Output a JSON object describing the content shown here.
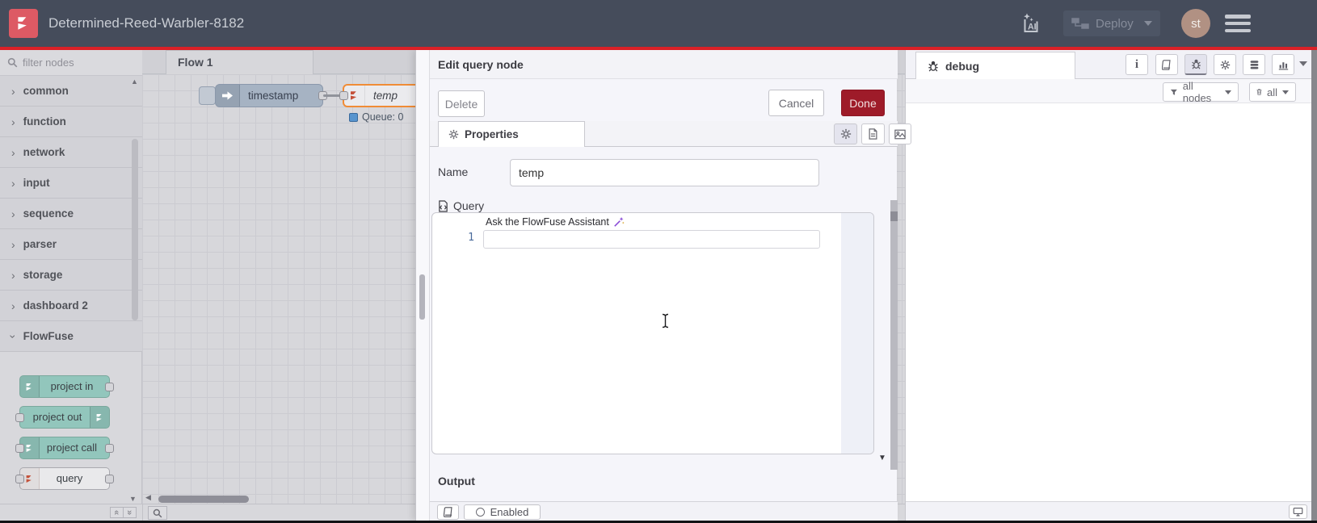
{
  "header": {
    "title": "Determined-Reed-Warbler-8182",
    "deploy_label": "Deploy",
    "avatar_initials": "st"
  },
  "palette": {
    "filter_placeholder": "filter nodes",
    "categories": [
      {
        "label": "common"
      },
      {
        "label": "function"
      },
      {
        "label": "network"
      },
      {
        "label": "input"
      },
      {
        "label": "sequence"
      },
      {
        "label": "parser"
      },
      {
        "label": "storage"
      },
      {
        "label": "dashboard 2"
      },
      {
        "label": "FlowFuse",
        "expanded": true
      }
    ],
    "flowfuse_nodes": [
      {
        "label": "project in"
      },
      {
        "label": "project out"
      },
      {
        "label": "project call"
      },
      {
        "label": "query"
      }
    ]
  },
  "canvas": {
    "tab_label": "Flow 1",
    "inject_node_label": "timestamp",
    "query_node_label": "temp",
    "status_text": "Queue: 0"
  },
  "tray": {
    "title": "Edit query node",
    "delete_label": "Delete",
    "cancel_label": "Cancel",
    "done_label": "Done",
    "properties_tab_label": "Properties",
    "name_label": "Name",
    "name_value": "temp",
    "query_section_label": "Query",
    "editor": {
      "line_number": "1",
      "assistant_placeholder": "Ask the FlowFuse Assistant"
    },
    "output_label": "Output",
    "enabled_label": "Enabled"
  },
  "debug": {
    "tab_label": "debug",
    "filter_all_nodes_label": "all nodes",
    "clear_all_label": "all"
  },
  "colors": {
    "header_bg": "#454c5b",
    "accent_red": "#da2027",
    "done_red": "#9e1b29",
    "logo_red": "#dd5a64",
    "node_teal": "#92c6bc",
    "node_gray_blue": "#a6b3c3",
    "selection_orange": "#f08c36",
    "status_blue": "#5794ce",
    "wand_purple": "#8a4bd6"
  }
}
